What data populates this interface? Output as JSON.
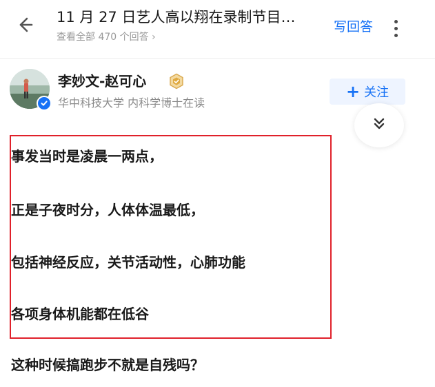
{
  "header": {
    "question_title": "11 月 27 日艺人高以翔在录制节目…",
    "answers_link": "查看全部 470 个回答 ›",
    "write_answer_label": "写回答"
  },
  "author": {
    "name": "李妙文-赵可心",
    "description": "华中科技大学 内科学博士在读",
    "follow_label": "关注",
    "follow_plus": "+"
  },
  "icons": {
    "back": "arrow-left-icon",
    "more": "more-vertical-icon",
    "collapse": "chevron-double-down-icon",
    "verified": "verified-check-icon",
    "level": "level-badge-icon"
  },
  "colors": {
    "accent": "#1772f6",
    "highlight_border": "#e0202a",
    "follow_bg": "#eef4ff"
  },
  "content": {
    "paragraphs": [
      "事发当时是凌晨一两点，",
      "正是子夜时分，人体体温最低，",
      "包括神经反应，关节活动性，心肺功能",
      "各项身体机能都在低谷",
      "这种时候搞跑步不就是自残吗？"
    ]
  }
}
